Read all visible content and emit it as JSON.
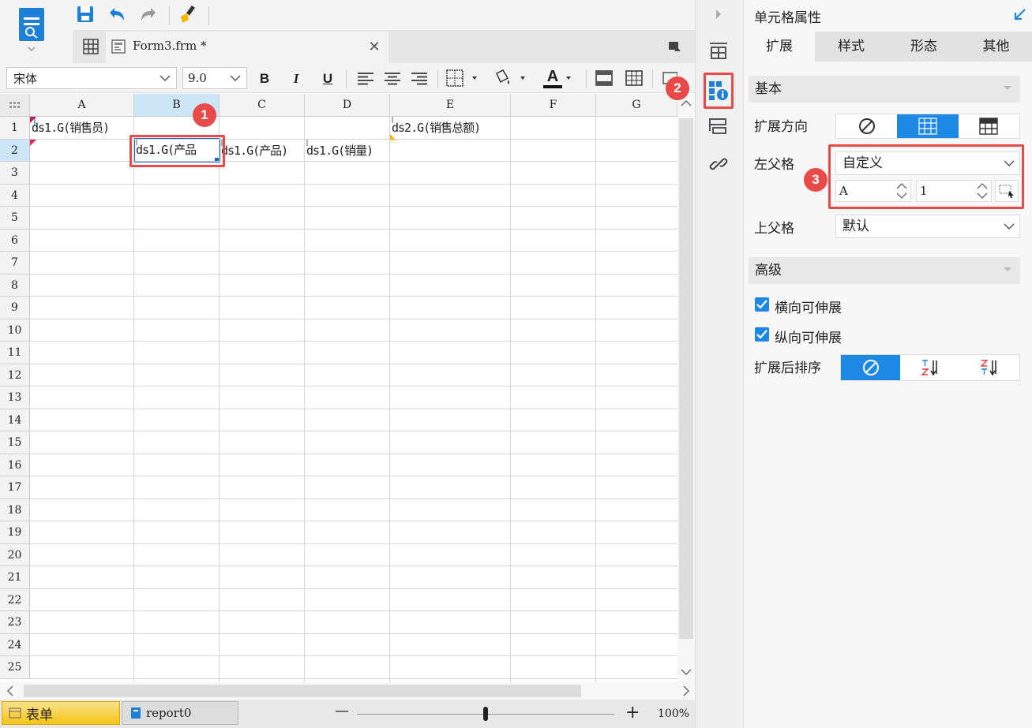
{
  "toolbar": {
    "file_tab": "Form3.frm *"
  },
  "format": {
    "font_name": "宋体",
    "font_size": "9.0",
    "bold": "B",
    "italic": "I",
    "underline": "U",
    "font_color_glyph": "A"
  },
  "grid": {
    "columns": [
      "A",
      "B",
      "C",
      "D",
      "E",
      "F",
      "G"
    ],
    "rows": [
      "1",
      "2",
      "3",
      "4",
      "5",
      "6",
      "7",
      "8",
      "9",
      "10",
      "11",
      "12",
      "13",
      "14",
      "15",
      "16",
      "17",
      "18",
      "19",
      "20",
      "21",
      "22",
      "23",
      "24",
      "25"
    ],
    "cells": {
      "A1": "ds1.G(销售员)",
      "B2": "ds1.G(产品",
      "C2": "ds1.G(产品)",
      "D2": "ds1.G(销量)",
      "E1": "ds2.G(销售总额)"
    }
  },
  "sheets": {
    "tab1": "表单",
    "tab2": "report0"
  },
  "zoom": {
    "minus": "—",
    "plus": "+",
    "value": "100%",
    "level_fraction": 0.5
  },
  "panel": {
    "title": "单元格属性",
    "tabs": [
      "扩展",
      "样式",
      "形态",
      "其他"
    ],
    "section_basic": "基本",
    "expand_dir_label": "扩展方向",
    "left_parent_label": "左父格",
    "left_parent_value": "自定义",
    "left_parent_col": "A",
    "left_parent_row": "1",
    "top_parent_label": "上父格",
    "top_parent_value": "默认",
    "section_advanced": "高级",
    "h_expand": "横向可伸展",
    "v_expand": "纵向可伸展",
    "sort_label": "扩展后排序"
  },
  "badges": [
    "1",
    "2",
    "3"
  ],
  "colors": {
    "accent": "#1e88e5",
    "highlight": "#e84a4a",
    "selected_header": "#cde6f7",
    "sheet_tab": "#f5c518"
  }
}
